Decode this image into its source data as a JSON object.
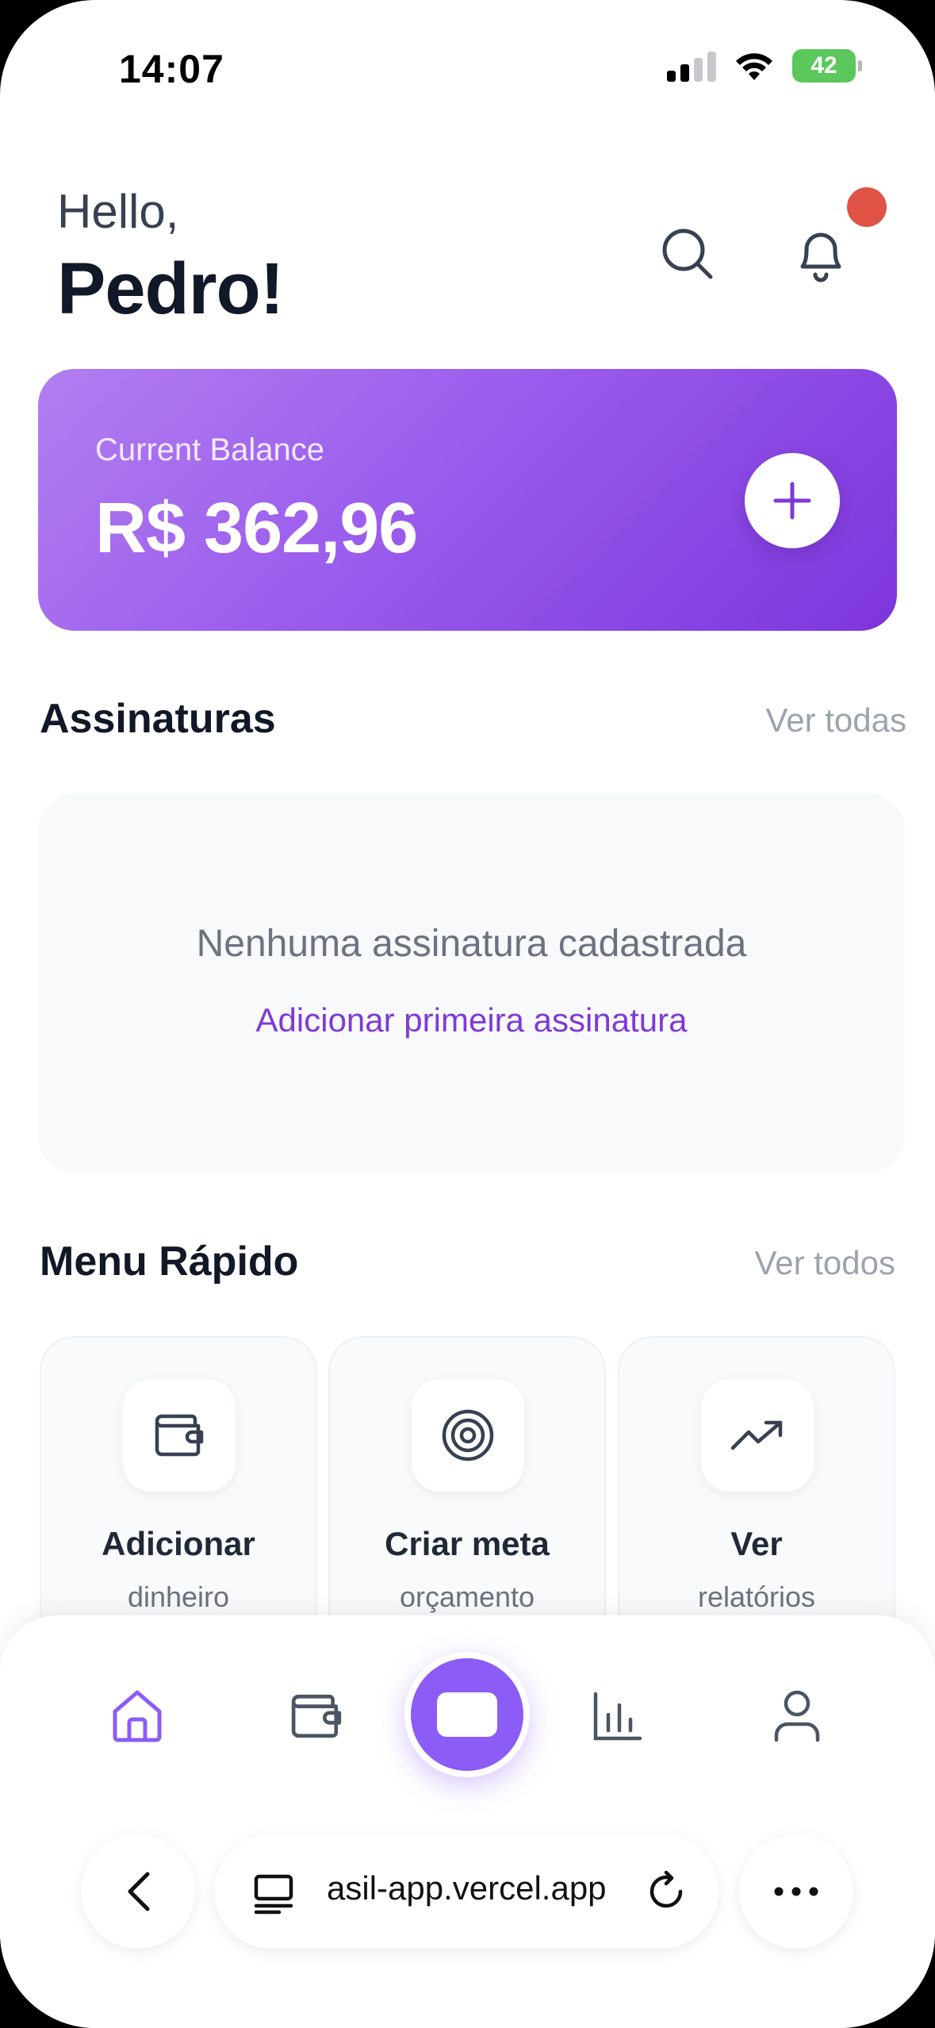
{
  "status_bar": {
    "time": "14:07",
    "battery": "42"
  },
  "header": {
    "greeting": "Hello,",
    "name": "Pedro!"
  },
  "balance": {
    "label": "Current Balance",
    "value": "R$ 362,96"
  },
  "subscriptions": {
    "title": "Assinaturas",
    "link": "Ver todas",
    "empty_text": "Nenhuma assinatura cadastrada",
    "empty_action": "Adicionar primeira assinatura"
  },
  "quick_menu": {
    "title": "Menu Rápido",
    "link": "Ver todos",
    "items": [
      {
        "title": "Adicionar",
        "subtitle": "dinheiro",
        "icon": "wallet-icon"
      },
      {
        "title": "Criar meta",
        "subtitle": "orçamento",
        "icon": "target-icon"
      },
      {
        "title": "Ver",
        "subtitle": "relatórios",
        "icon": "trending-up-icon"
      }
    ]
  },
  "bottom_nav": {
    "items": [
      "home-icon",
      "wallet-icon",
      "card-icon",
      "bar-chart-icon",
      "user-icon"
    ],
    "active": "home-icon"
  },
  "browser": {
    "url": "asil-app.vercel.app"
  },
  "colors": {
    "accent": "#8b5cf6",
    "notification": "#e05245",
    "link": "#7e3ad6"
  }
}
